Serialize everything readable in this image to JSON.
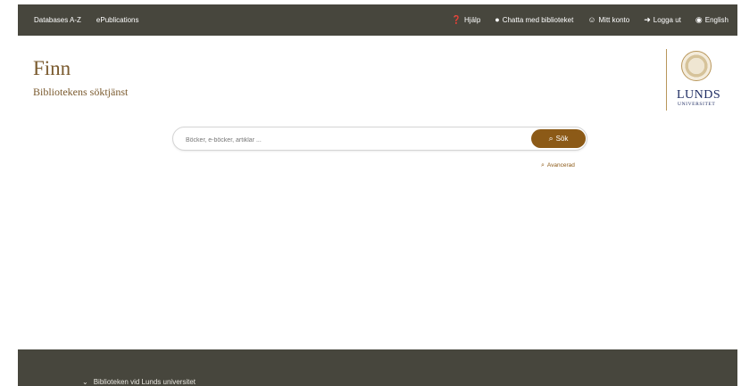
{
  "topnav": {
    "left": [
      {
        "label": "Databases A-Z"
      },
      {
        "label": "ePublications"
      }
    ],
    "right": [
      {
        "icon": "help-circle-icon",
        "label": "Hjälp"
      },
      {
        "icon": "chat-bubble-icon",
        "label": "Chatta med biblioteket"
      },
      {
        "icon": "user-circle-icon",
        "label": "Mitt konto"
      },
      {
        "icon": "logout-icon",
        "label": "Logga ut"
      },
      {
        "icon": "globe-icon",
        "label": "English"
      }
    ]
  },
  "brand": {
    "title": "Finn",
    "subtitle": "Bibliotekens söktjänst"
  },
  "logo": {
    "name": "LUNDS",
    "sub": "UNIVERSITET"
  },
  "search": {
    "placeholder": "Böcker, e-böcker, artiklar ...",
    "value": "",
    "button_label": "Sök",
    "advanced_label": "Avancerad"
  },
  "footer": {
    "toggle_label": "Biblioteken vid Lunds universitet"
  },
  "colors": {
    "nav_bg": "#47463d",
    "accent": "#8c5a17",
    "brand_text": "#7a5a2e",
    "logo_blue": "#1f2d63"
  }
}
